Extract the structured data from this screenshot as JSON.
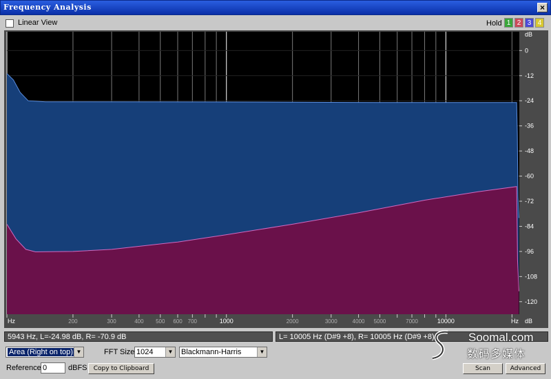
{
  "window": {
    "title": "Frequency Analysis",
    "close_glyph": "×"
  },
  "top": {
    "linear_view_label": "Linear View",
    "linear_view_checked": false,
    "hold_label": "Hold",
    "hold_buttons": [
      {
        "label": "1",
        "color": "#3aa63a"
      },
      {
        "label": "2",
        "color": "#cc4a5a"
      },
      {
        "label": "3",
        "color": "#4a4ad8"
      },
      {
        "label": "4",
        "color": "#d8c832"
      }
    ]
  },
  "chart_data": {
    "type": "area",
    "xscale": "log",
    "x_unit_label_left": "Hz",
    "x_unit_label_right": "Hz",
    "x_ticks": [
      {
        "value": 200,
        "label": "200"
      },
      {
        "value": 300,
        "label": "300"
      },
      {
        "value": 400,
        "label": "400"
      },
      {
        "value": 500,
        "label": "500"
      },
      {
        "value": 600,
        "label": "600"
      },
      {
        "value": 700,
        "label": "700"
      },
      {
        "value": 1000,
        "label": "1000"
      },
      {
        "value": 2000,
        "label": "2000"
      },
      {
        "value": 3000,
        "label": "3000"
      },
      {
        "value": 4000,
        "label": "4000"
      },
      {
        "value": 5000,
        "label": "5000"
      },
      {
        "value": 7000,
        "label": "7000"
      },
      {
        "value": 10000,
        "label": "10000"
      }
    ],
    "y_unit_label_top": "dB",
    "y_unit_label_bottom": "dB",
    "y_ticks": [
      0,
      -12,
      -24,
      -36,
      -48,
      -60,
      -72,
      -84,
      -96,
      -108,
      -120
    ],
    "ylim": [
      -126,
      9
    ],
    "series": [
      {
        "color": "#163f79",
        "line_color": "#5a8ee0",
        "points": [
          [
            100,
            -11
          ],
          [
            107,
            -14
          ],
          [
            115,
            -20
          ],
          [
            125,
            -24
          ],
          [
            150,
            -24.5
          ],
          [
            1000,
            -24.6
          ],
          [
            5000,
            -24.8
          ],
          [
            21000,
            -24.8
          ],
          [
            21150,
            -40
          ],
          [
            21300,
            -70
          ],
          [
            21500,
            -80
          ]
        ]
      },
      {
        "color": "#6a114a",
        "line_color": "#d06ac0",
        "points": [
          [
            100,
            -83
          ],
          [
            110,
            -90
          ],
          [
            122,
            -95
          ],
          [
            135,
            -96.2
          ],
          [
            200,
            -96
          ],
          [
            300,
            -95
          ],
          [
            600,
            -91.5
          ],
          [
            1000,
            -88
          ],
          [
            2000,
            -83
          ],
          [
            4000,
            -77.5
          ],
          [
            8000,
            -71.5
          ],
          [
            14000,
            -67.5
          ],
          [
            21000,
            -65
          ],
          [
            21200,
            -100
          ],
          [
            21500,
            -115
          ]
        ]
      }
    ]
  },
  "status": {
    "cursor_readout": "5943 Hz, L=-24.98 dB, R= -70.9 dB",
    "peak_readout": "L=  10005 Hz (D#9 +8), R=  10005 Hz (D#9 +8)"
  },
  "controls": {
    "view_mode": "Area (Right on top)",
    "fft_size_label": "FFT Size",
    "fft_size": "1024",
    "window_function": "Blackmann-Harris",
    "reference_label": "Reference",
    "reference_value": "0",
    "reference_unit": "dBFS",
    "copy_button": "Copy to Clipboard",
    "scan_button": "Scan",
    "advanced_button": "Advanced"
  },
  "watermark": {
    "brand": "Soomal.com",
    "subtitle": "数码多媒体"
  }
}
